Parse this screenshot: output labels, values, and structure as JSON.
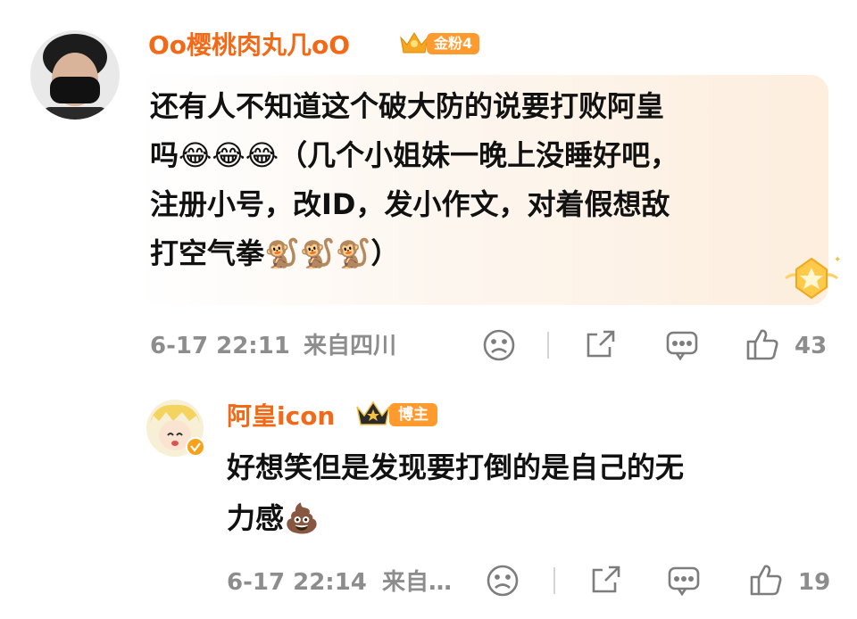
{
  "comment": {
    "username": "Oo樱桃肉丸几oO",
    "fan_badge": "金粉4",
    "text_lines": [
      "还有人不知道这个破大防的说要打败阿皇",
      "吗😂😂😂（几个小姐妹一晚上没睡好吧，",
      "注册小号，改ID，发小作文，对着假想敌",
      "打空气拳🐒🐒🐒）"
    ],
    "time": "6-17 22:11",
    "location": "来自四川",
    "likes": "43"
  },
  "reply": {
    "username": "阿皇icon",
    "role_badge": "博主",
    "text_lines": [
      "好想笑但是发现要打倒的是自己的无",
      "力感💩"
    ],
    "time": "6-17 22:14",
    "location": "来自…",
    "likes": "19"
  },
  "icons": [
    "sad-face-icon",
    "share-icon",
    "comment-icon",
    "thumbs-up-icon",
    "crown-icon",
    "star-badge-icon",
    "verified-icon"
  ],
  "colors": {
    "username": "#f26a17",
    "badge": "#ff9a2e",
    "meta": "#8d8d8d",
    "highlight": "#fdf2e6"
  }
}
